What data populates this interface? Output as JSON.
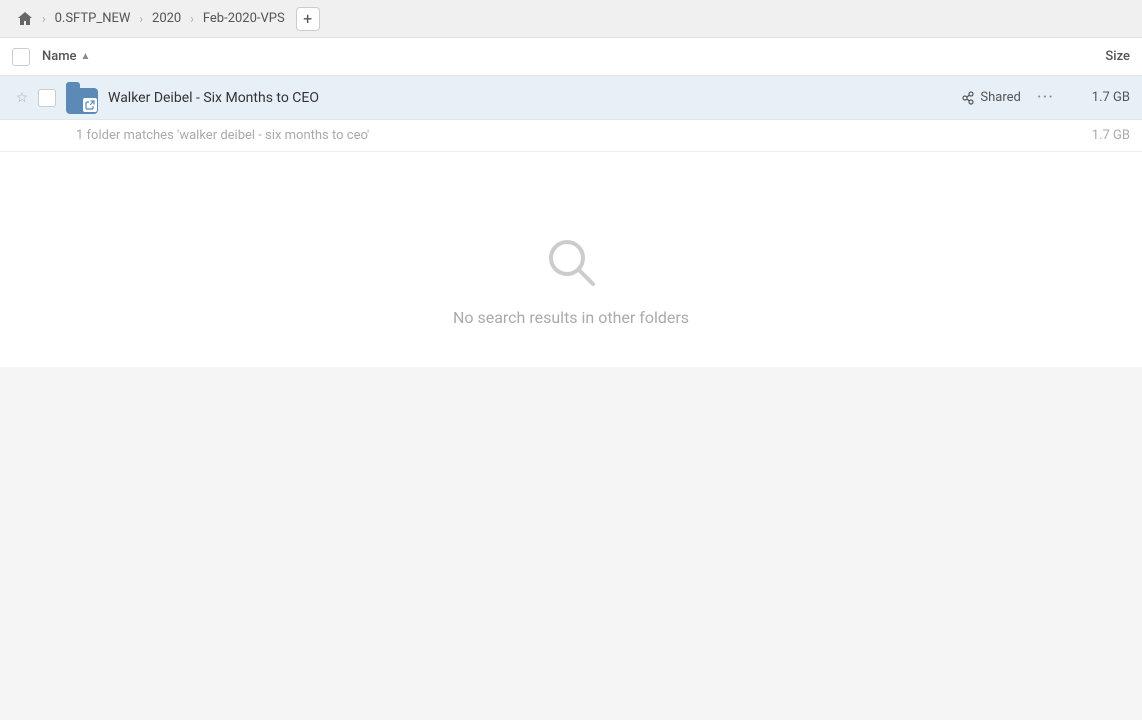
{
  "breadcrumb": {
    "home_icon": "🏠",
    "items": [
      {
        "label": "0.SFTP_NEW",
        "id": "sftp"
      },
      {
        "label": "2020",
        "id": "2020"
      },
      {
        "label": "Feb-2020-VPS",
        "id": "feb2020vps"
      }
    ],
    "add_label": "+"
  },
  "table": {
    "header": {
      "name_label": "Name",
      "sort_arrow": "▲",
      "size_label": "Size"
    },
    "rows": [
      {
        "name": "Walker Deibel - Six Months to CEO",
        "shared_label": "Shared",
        "size": "1.7 GB",
        "starred": false
      }
    ],
    "match_info": "1 folder matches 'walker deibel - six months to ceo'",
    "match_size": "1.7 GB"
  },
  "empty_state": {
    "message": "No search results in other folders"
  },
  "icons": {
    "star": "☆",
    "link": "🔗",
    "more": "···",
    "home": "⌂"
  }
}
